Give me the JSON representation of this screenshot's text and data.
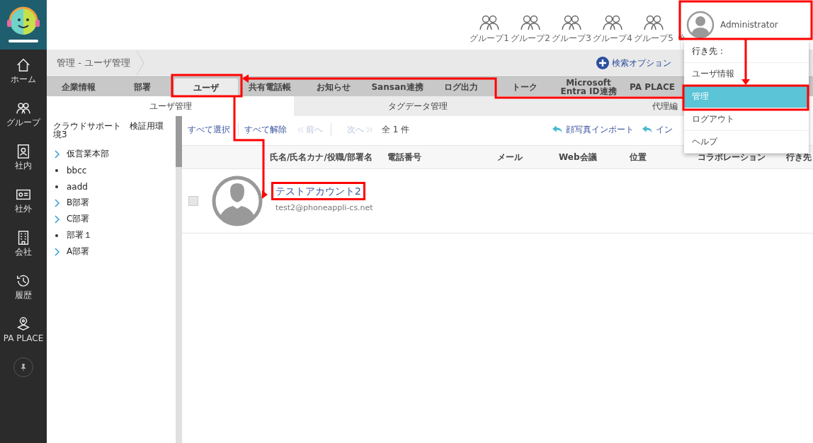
{
  "header": {
    "groups": [
      "グループ1",
      "グループ2",
      "グループ3",
      "グループ4",
      "グループ5"
    ],
    "user": "Administrator"
  },
  "sidebar": {
    "items": [
      {
        "kind": "home",
        "label": "ホーム"
      },
      {
        "kind": "group",
        "label": "グループ"
      },
      {
        "kind": "internal",
        "label": "社内"
      },
      {
        "kind": "external",
        "label": "社外"
      },
      {
        "kind": "company",
        "label": "会社"
      },
      {
        "kind": "history",
        "label": "履歴"
      },
      {
        "kind": "place",
        "label": "PA PLACE"
      }
    ]
  },
  "breadcrumb": "管理 - ユーザ管理",
  "search_options": "検索オプション",
  "tabs": [
    {
      "label": "企業情報",
      "selected": false
    },
    {
      "label": "部署",
      "selected": false
    },
    {
      "label": "ユーザ",
      "selected": true
    },
    {
      "label": "共有電話帳",
      "selected": false
    },
    {
      "label": "お知らせ",
      "selected": false
    },
    {
      "label": "Sansan連携",
      "selected": false
    },
    {
      "label": "ログ出力",
      "selected": false
    },
    {
      "label": "トーク",
      "selected": false
    },
    {
      "label": "Microsoft Entra ID連携",
      "selected": false
    },
    {
      "label": "PA PLACE",
      "selected": false
    }
  ],
  "subtabs": [
    {
      "label": "ユーザ管理",
      "selected": true
    },
    {
      "label": "タグデータ管理",
      "selected": false
    },
    {
      "label": "代理編",
      "selected": false
    }
  ],
  "tree": {
    "title": "クラウドサポート　検証用環境3",
    "items": [
      {
        "kind": "branch",
        "label": "仮営業本部"
      },
      {
        "kind": "leaf",
        "label": "bbcc"
      },
      {
        "kind": "leaf",
        "label": "aadd"
      },
      {
        "kind": "branch",
        "label": "B部署"
      },
      {
        "kind": "branch",
        "label": "C部署"
      },
      {
        "kind": "leaf",
        "label": "部署１"
      },
      {
        "kind": "branch",
        "label": "A部署"
      }
    ]
  },
  "toolbar": {
    "select_all": "すべて選択",
    "clear_all": "すべて解除",
    "prev": {
      "label": "前へ",
      "disabled": true
    },
    "next": {
      "label": "次へ",
      "disabled": true
    },
    "count": "全 1 件",
    "photo_import": "顔写真インポート",
    "import": "イン"
  },
  "columns": [
    "氏名/氏名カナ/役職/部署名",
    "電話番号",
    "メール",
    "Web会議",
    "位置",
    "コラボレーション",
    "行き先"
  ],
  "rows": [
    {
      "name": "テストアカウント2",
      "email": "test2@phoneappli-cs.net",
      "checked": false
    }
  ],
  "menu": {
    "items": [
      {
        "kind": "heading",
        "label": "行き先：",
        "selected": false
      },
      {
        "kind": "item",
        "label": "ユーザ情報",
        "selected": false
      },
      {
        "kind": "item",
        "label": "管理",
        "selected": true
      },
      {
        "kind": "item",
        "label": "ログアウト",
        "selected": false
      },
      {
        "kind": "item",
        "label": "ヘルプ",
        "selected": false
      }
    ]
  }
}
